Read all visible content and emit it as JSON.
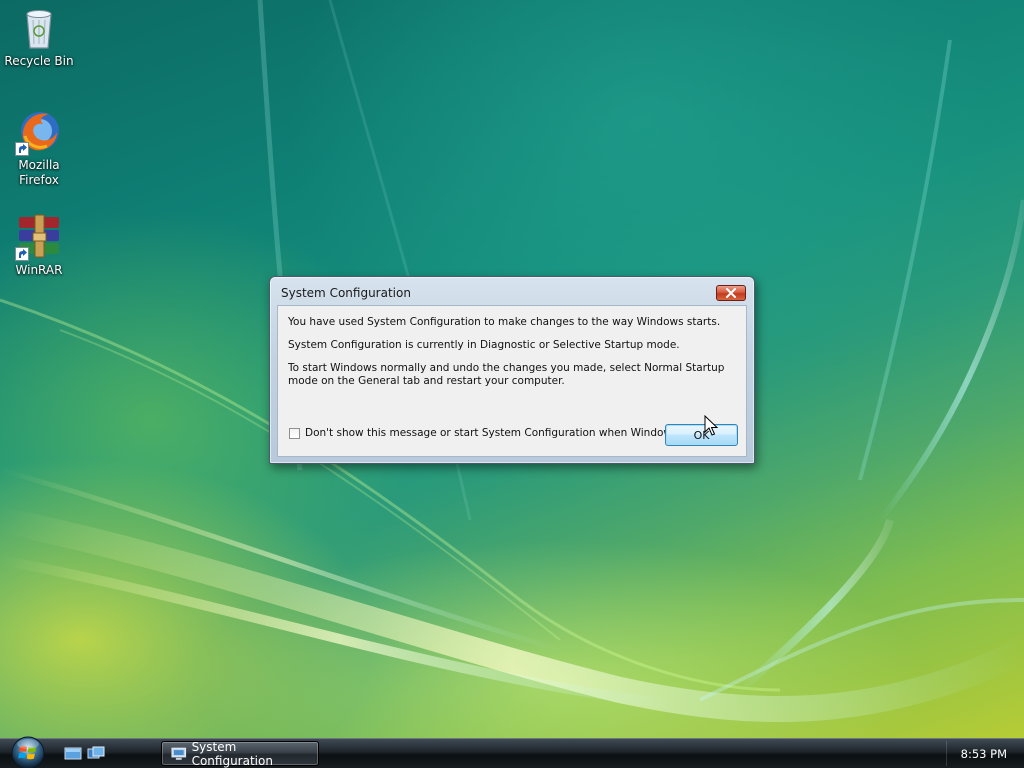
{
  "desktop": {
    "icons": [
      {
        "label": "Recycle Bin",
        "icon": "recycle-bin-icon"
      },
      {
        "label": "Mozilla\nFirefox",
        "icon": "firefox-icon"
      },
      {
        "label": "WinRAR",
        "icon": "winrar-icon"
      }
    ]
  },
  "dialog": {
    "title": "System Configuration",
    "close_icon": "close-icon",
    "message_1": "You have used System Configuration to make changes to the way Windows starts.",
    "message_2": "System Configuration is currently in Diagnostic or Selective Startup mode.",
    "message_3": "To start Windows normally and undo the changes you made, select Normal Startup mode on the General tab and restart your computer.",
    "checkbox_label": "Don't show this message or start System Configuration when Windows starts",
    "checkbox_checked": false,
    "ok_label": "OK"
  },
  "taskbar": {
    "start_icon": "windows-start-orb-icon",
    "quick_launch": [
      {
        "icon": "show-desktop-icon"
      },
      {
        "icon": "switch-windows-icon"
      }
    ],
    "tasks": [
      {
        "label": "System Configuration",
        "icon": "system-configuration-icon"
      }
    ],
    "clock": "8:53 PM"
  },
  "colors": {
    "dialog_button_accent": "#3c7fb1",
    "close_button": "#c23a1e",
    "taskbar": "#1d242a"
  }
}
